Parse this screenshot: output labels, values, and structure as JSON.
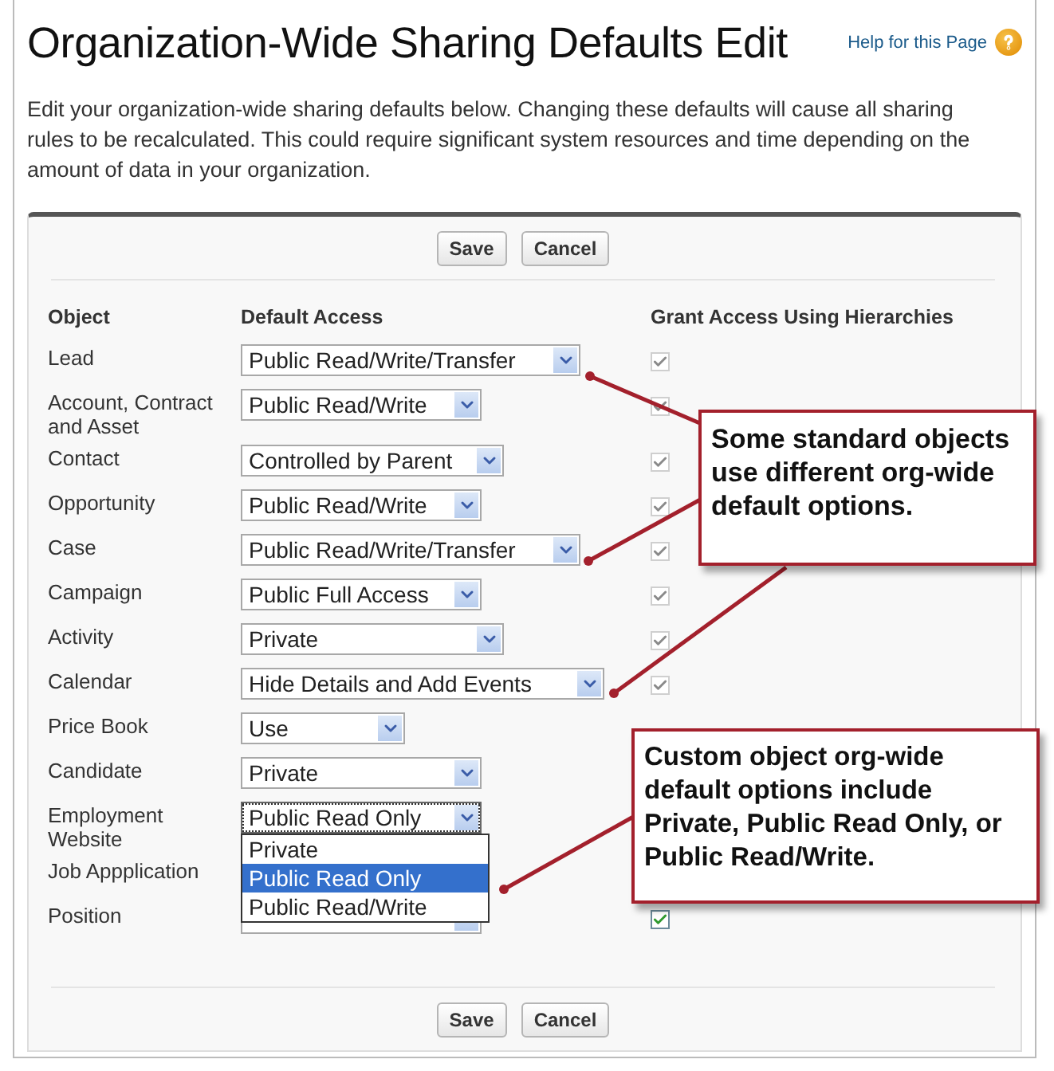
{
  "page": {
    "title": "Organization-Wide Sharing Defaults Edit",
    "help_link": "Help for this Page",
    "description": "Edit your organization-wide sharing defaults below. Changing these defaults will cause all sharing rules to be recalculated. This could require significant system resources and time depending on the amount of data in your organization."
  },
  "buttons_top": [
    "Save",
    "Cancel"
  ],
  "table": {
    "columns": [
      "Object",
      "Default Access",
      "Grant Access Using Hierarchies"
    ],
    "rows": [
      {
        "object": "Lead",
        "access": "Public Read/Write/Transfer",
        "open": false,
        "grant": {
          "checked": true,
          "disabled": true
        }
      },
      {
        "object": "Account, Contract and Asset",
        "access": "Public Read/Write",
        "open": false,
        "grant": {
          "checked": true,
          "disabled": true
        }
      },
      {
        "object": "Contact",
        "access": "Controlled by Parent",
        "open": false,
        "grant": {
          "checked": true,
          "disabled": true
        }
      },
      {
        "object": "Opportunity",
        "access": "Public Read/Write",
        "open": false,
        "grant": {
          "checked": true,
          "disabled": true
        }
      },
      {
        "object": "Case",
        "access": "Public Read/Write/Transfer",
        "open": false,
        "grant": {
          "checked": true,
          "disabled": true
        }
      },
      {
        "object": "Campaign",
        "access": "Public Full Access",
        "open": false,
        "grant": {
          "checked": true,
          "disabled": true
        }
      },
      {
        "object": "Activity",
        "access": "Private",
        "open": false,
        "grant": {
          "checked": true,
          "disabled": true
        }
      },
      {
        "object": "Calendar",
        "access": "Hide Details and Add Events",
        "open": false,
        "grant": {
          "checked": true,
          "disabled": true
        }
      },
      {
        "object": "Price Book",
        "access": "Use",
        "open": false
      },
      {
        "object": "Candidate",
        "access": "Private",
        "open": false
      },
      {
        "object": "Employment Website",
        "access": "Public Read Only",
        "open": true,
        "options": [
          {
            "label": "Private",
            "selected": false
          },
          {
            "label": "Public Read Only",
            "selected": true
          },
          {
            "label": "Public Read/Write",
            "selected": false
          }
        ]
      },
      {
        "object": "Job Appplication"
      },
      {
        "object": "Position",
        "open": false,
        "grant": {
          "checked": true,
          "disabled": false
        }
      }
    ]
  },
  "buttons_bottom": [
    "Save",
    "Cancel"
  ],
  "callouts": [
    {
      "text": "Some standard objects use different org-wide default options."
    },
    {
      "text": "Custom object org-wide default options include Private, Public Read Only, or Public Read/Write."
    }
  ]
}
